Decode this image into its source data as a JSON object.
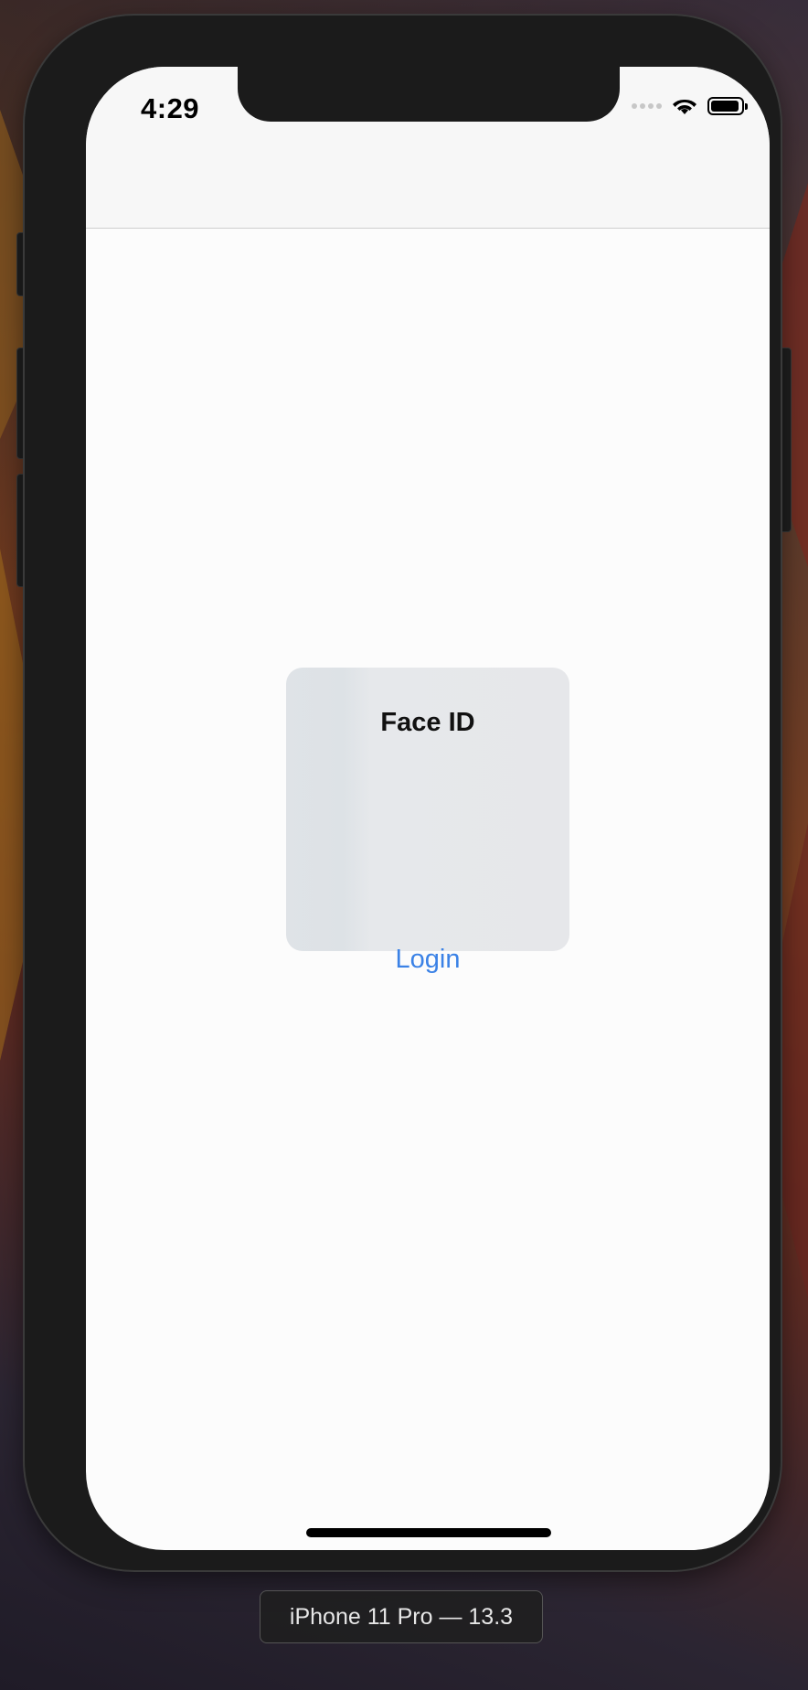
{
  "status_bar": {
    "time": "4:29",
    "battery_level": 0.95
  },
  "icons": {
    "wifi": "wifi-icon",
    "battery": "battery-icon",
    "signal": "cellular-signal-icon"
  },
  "faceid": {
    "title": "Face ID"
  },
  "main": {
    "login_label": "Login"
  },
  "simulator": {
    "device_label": "iPhone 11 Pro — 13.3"
  },
  "colors": {
    "link": "#3b82e6",
    "screen_bg": "#fcfcfc",
    "device_frame": "#1b1b1b"
  }
}
